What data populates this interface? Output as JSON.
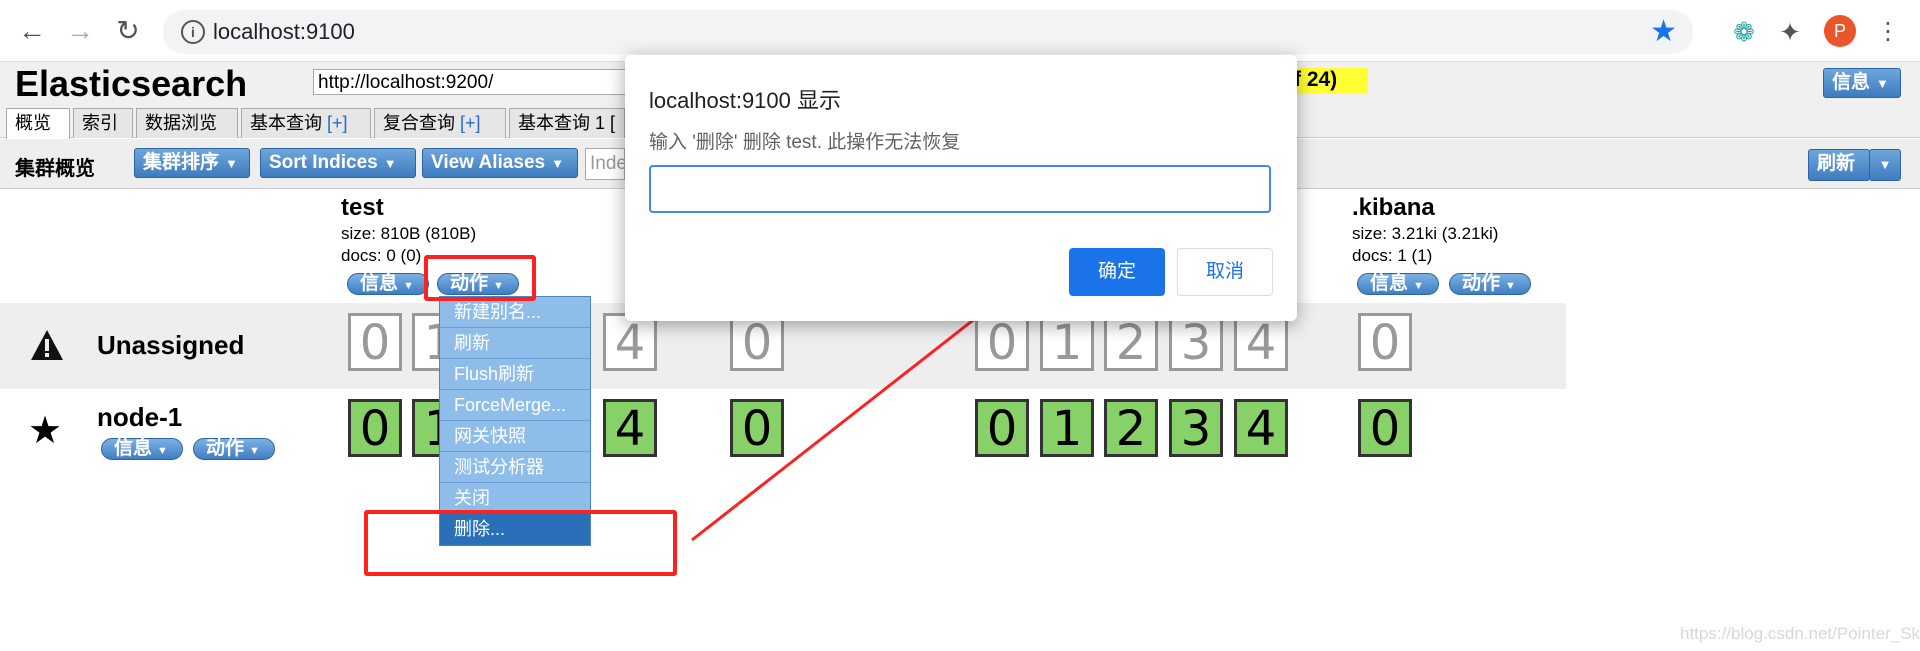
{
  "browser": {
    "url": "localhost:9100",
    "profile_initial": "P",
    "back_icon": "arrow-left",
    "forward_icon": "arrow-right",
    "reload_icon": "reload",
    "bookmark_icon": "star",
    "extension_icon": "puzzle"
  },
  "app": {
    "title": "Elasticsearch",
    "connect_url": "http://localhost:9200/",
    "health_text": "f 24)",
    "info_button": "信息",
    "tabs": [
      {
        "label": "概览",
        "plus": ""
      },
      {
        "label": "索引",
        "plus": ""
      },
      {
        "label": "数据浏览",
        "plus": ""
      },
      {
        "label": "基本查询 ",
        "plus": "[+]"
      },
      {
        "label": "复合查询 ",
        "plus": "[+]"
      },
      {
        "label": "基本查询 1 [",
        "plus": ""
      }
    ],
    "toolbar": {
      "title": "集群概览",
      "sort_cluster": "集群排序",
      "sort_indices": "Sort Indices",
      "view_aliases": "View Aliases",
      "index_filter_placeholder": "Inde",
      "refresh": "刷新"
    },
    "indices": [
      {
        "name": "test",
        "size": "size: 810B (810B)",
        "docs": "docs: 0 (0)",
        "info": "信息",
        "action": "动作"
      },
      {
        "name": ".kibana",
        "size": "size: 3.21ki (3.21ki)",
        "docs": "docs: 1 (1)",
        "info": "信息",
        "action": "动作"
      }
    ],
    "rows": {
      "unassigned": "Unassigned",
      "node": "node-1",
      "node_info": "信息",
      "node_action": "动作"
    },
    "shards": {
      "test": [
        "0",
        "1",
        "4"
      ],
      "mid": [
        "0"
      ],
      "right": [
        "0",
        "1",
        "2",
        "3",
        "4"
      ],
      "kibana": [
        "0"
      ]
    },
    "menu": [
      "新建别名...",
      "刷新",
      "Flush刷新",
      "ForceMerge...",
      "网关快照",
      "测试分析器",
      "关闭",
      "删除..."
    ]
  },
  "dialog": {
    "title": "localhost:9100 显示",
    "message": "输入 '删除'  删除 test. 此操作无法恢复",
    "input_value": "",
    "ok": "确定",
    "cancel": "取消"
  },
  "watermark": "https://blog.csdn.net/Pointer_Sky",
  "colors": {
    "accent_blue": "#3e7bc0",
    "assigned_shard": "#88d068",
    "annotation_red": "#ff2020",
    "health_yellow": "#ffff33"
  }
}
